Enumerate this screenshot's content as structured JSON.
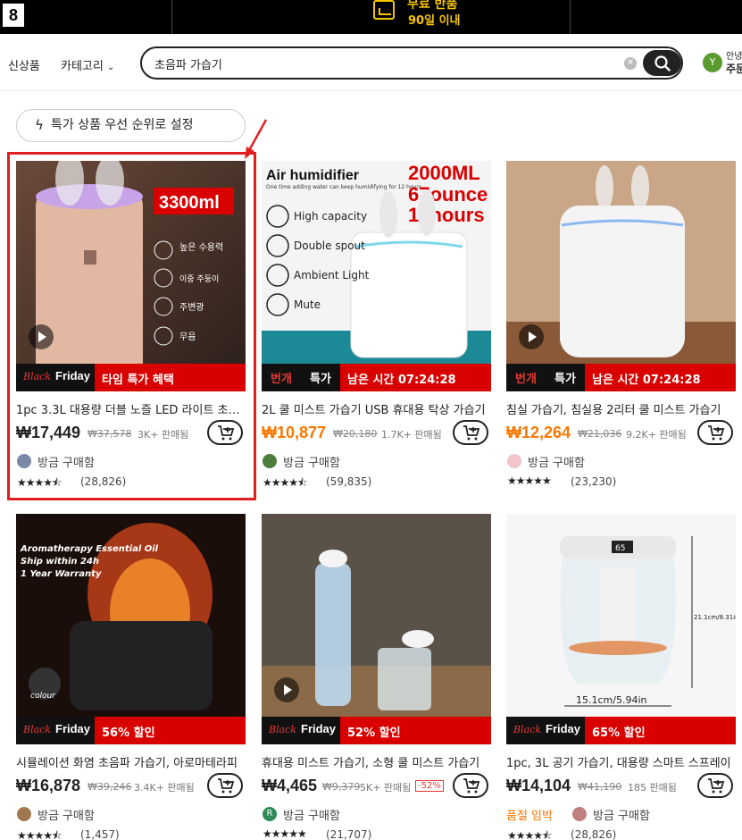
{
  "header": {
    "logo_text": "8",
    "return_line1": "무료 반품",
    "return_line2": "90일 이내"
  },
  "nav": {
    "new_label": "신상품",
    "category_label": "카테고리",
    "search": {
      "value": "초음파 가습기",
      "placeholder": ""
    },
    "avatar_initial": "Y",
    "greeting_line1": "안녕",
    "greeting_line2": "주문"
  },
  "filter": {
    "priority_label": "특가 상품 우선 순위로 설정"
  },
  "colors": {
    "accent_orange": "#fb7701",
    "banner_red": "#d90000",
    "highlight_red": "#e02020"
  },
  "products": [
    {
      "title": "1pc 3.3L 대용량 더블 노즐 LED 라이트 초음파 가습기",
      "price": "₩17,449",
      "orig_price": "₩37,578",
      "sold": "3K+ 판매됨",
      "banner_type": "blackfriday",
      "banner_text": "타임 특가 혜택",
      "buy_text": "방금 구매함",
      "stars": "★★★★⯪",
      "reviews": "(28,826)",
      "image_labels": [
        "3300ml",
        "높은 수용력",
        "이중 주둥이",
        "주변광",
        "무음"
      ]
    },
    {
      "title": "2L 쿨 미스트 가습기 USB 휴대용 탁상 가습기",
      "price": "₩10,877",
      "orig_price": "₩20,180",
      "sold": "1.7K+ 판매됨",
      "banner_type": "flash",
      "banner_flash": "번개",
      "banner_flash2": "특가",
      "banner_text": "남은 시간 07:24:28",
      "buy_text": "방금 구매함",
      "stars": "★★★★⯪",
      "reviews": "(59,835)",
      "image_labels": [
        "Air humidifier",
        "One time adding water can keep humidifying for 12 hours",
        "2000ML",
        "67ounce",
        "12hours",
        "High capacity",
        "Double spout",
        "Ambient Light",
        "Mute"
      ]
    },
    {
      "title": "침실 가습기, 침실용 2리터 쿨 미스트 가습기",
      "price": "₩12,264",
      "orig_price": "₩21,036",
      "sold": "9.2K+ 판매됨",
      "banner_type": "flash",
      "banner_flash": "번개",
      "banner_flash2": "특가",
      "banner_text": "남은 시간 07:24:28",
      "buy_text": "방금 구매함",
      "stars": "★★★★★",
      "reviews": "(23,230)"
    },
    {
      "title": "시뮬레이션 화염 초음파 가습기, 아로마테라피",
      "price": "₩16,878",
      "orig_price": "₩39,246",
      "sold": "3.4K+ 판매됨",
      "banner_type": "blackfriday",
      "banner_text": "56% 할인",
      "buy_text": "방금 구매함",
      "stars": "★★★★⯪",
      "reviews": "(1,457)",
      "image_labels": [
        "Aromatherapy Essential Oil",
        "Ship within 24h",
        "1 Year Warranty",
        "colour"
      ]
    },
    {
      "title": "휴대용 미스트 가습기, 소형 쿨 미스트 가습기",
      "price": "₩4,465",
      "orig_price": "₩9,379",
      "sold": "5K+ 판매됨",
      "discount": "-52%",
      "banner_type": "blackfriday",
      "banner_text": "52% 할인",
      "buy_text": "방금 구매함",
      "avatar_letter": "R",
      "stars": "★★★★★",
      "reviews": "(21,707)"
    },
    {
      "title": "1pc, 3L 공기 가습기, 대용량 스마트 스프레이",
      "price": "₩14,104",
      "orig_price": "₩41,190",
      "sold": "185 판매됨",
      "banner_type": "blackfriday",
      "banner_text": "65% 할인",
      "soon_text": "품절 임박",
      "buy_text": "방금 구매함",
      "stars": "★★★★⯪",
      "reviews": "(28,826)",
      "image_labels": [
        "15.1cm/5.94in",
        "21.1cm/8.31in",
        "65"
      ]
    }
  ],
  "blackfriday": {
    "word1": "Black",
    "word2": "Friday"
  }
}
